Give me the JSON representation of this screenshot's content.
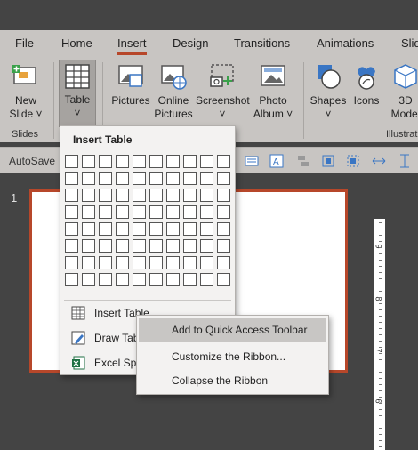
{
  "tabs": [
    "File",
    "Home",
    "Insert",
    "Design",
    "Transitions",
    "Animations",
    "Slid"
  ],
  "active_tab": "Insert",
  "ribbon": {
    "new_slide": [
      "New",
      "Slide ˅"
    ],
    "table": [
      "Table",
      "˅"
    ],
    "pictures": "Pictures",
    "online_pictures": [
      "Online",
      "Pictures"
    ],
    "screenshot": [
      "Screenshot",
      "˅"
    ],
    "photo_album": [
      "Photo",
      "Album ˅"
    ],
    "shapes": [
      "Shapes",
      "˅"
    ],
    "icons": "Icons",
    "models3d": [
      "3D",
      "Model"
    ],
    "group_slides": "Slides",
    "group_illustrations": "Illustrati"
  },
  "qat": {
    "autosave": "AutoSave"
  },
  "slide": {
    "number": "1"
  },
  "ruler": [
    "9",
    "8",
    "7",
    "6"
  ],
  "insert_table": {
    "title": "Insert Table",
    "items": [
      {
        "label": "Insert Table...",
        "icon": "table-grid-icon"
      },
      {
        "label": "Draw Table",
        "icon": "draw-table-icon"
      },
      {
        "label": "Excel Spreadsheet",
        "icon": "excel-icon"
      }
    ]
  },
  "context_menu": {
    "items": [
      "Add to Quick Access Toolbar",
      "Customize the Ribbon...",
      "Collapse the Ribbon"
    ],
    "hovered_index": 0
  },
  "colors": {
    "accent": "#b7472a",
    "ribbon_bg": "#c8c5c2",
    "workspace_bg": "#444444"
  }
}
